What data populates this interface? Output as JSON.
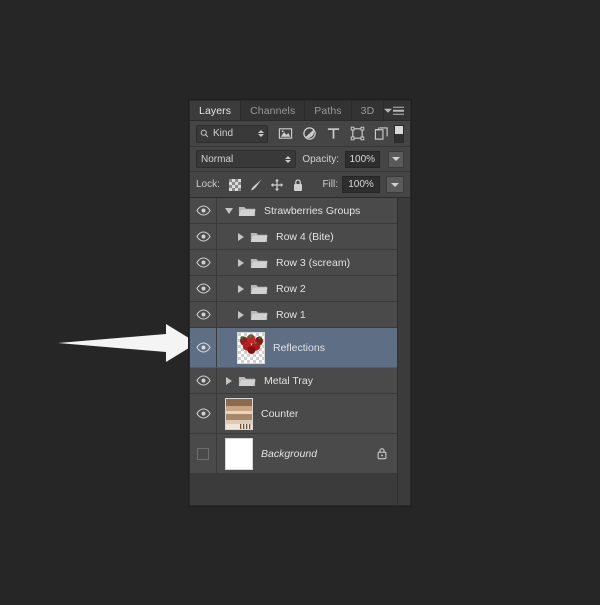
{
  "canvas": {
    "background_color": "#262626"
  },
  "annotation": {
    "name": "pointer-arrow",
    "color": "#f2f2f2",
    "points_to": "Reflections"
  },
  "panel": {
    "title": "Layers",
    "tabs": [
      {
        "label": "Layers",
        "active": true
      },
      {
        "label": "Channels",
        "active": false
      },
      {
        "label": "Paths",
        "active": false
      },
      {
        "label": "3D",
        "active": false
      }
    ],
    "panel_menu_icon": "panel-menu-icon",
    "filter": {
      "kind_label": "Kind",
      "search_icon": "search-icon",
      "icons": [
        "pixel-layer-filter-icon",
        "adjustment-layer-filter-icon",
        "type-layer-filter-icon",
        "shape-layer-filter-icon",
        "smart-object-filter-icon"
      ],
      "toggle_icon": "filter-enable-toggle"
    },
    "blend": {
      "mode_label": "Normal",
      "opacity_label": "Opacity:",
      "opacity_value": "100%"
    },
    "lock": {
      "label": "Lock:",
      "icons": [
        "lock-transparent-pixels-icon",
        "lock-image-pixels-icon",
        "lock-position-icon",
        "lock-all-icon"
      ],
      "fill_label": "Fill:",
      "fill_value": "100%"
    },
    "layers": [
      {
        "name": "Strawberries Groups",
        "type": "group",
        "expanded": true,
        "indent": 0,
        "visible": true,
        "selected": false,
        "locked": false,
        "thumb": "none"
      },
      {
        "name": "Row 4 (Bite)",
        "type": "group",
        "expanded": false,
        "indent": 1,
        "visible": true,
        "selected": false,
        "locked": false,
        "thumb": "none"
      },
      {
        "name": "Row 3 (scream)",
        "type": "group",
        "expanded": false,
        "indent": 1,
        "visible": true,
        "selected": false,
        "locked": false,
        "thumb": "none"
      },
      {
        "name": "Row 2",
        "type": "group",
        "expanded": false,
        "indent": 1,
        "visible": true,
        "selected": false,
        "locked": false,
        "thumb": "none"
      },
      {
        "name": "Row 1",
        "type": "group",
        "expanded": false,
        "indent": 1,
        "visible": true,
        "selected": false,
        "locked": false,
        "thumb": "none"
      },
      {
        "name": "Reflections",
        "type": "layer",
        "expanded": false,
        "indent": 1,
        "visible": true,
        "selected": true,
        "locked": false,
        "thumb": "strawberries-transparent"
      },
      {
        "name": "Metal Tray",
        "type": "group",
        "expanded": false,
        "indent": 0,
        "visible": true,
        "selected": false,
        "locked": false,
        "thumb": "none"
      },
      {
        "name": "Counter",
        "type": "layer",
        "expanded": false,
        "indent": 0,
        "visible": true,
        "selected": false,
        "locked": false,
        "thumb": "wood-counter"
      },
      {
        "name": "Background",
        "type": "layer",
        "expanded": false,
        "indent": 0,
        "visible": false,
        "selected": false,
        "locked": true,
        "thumb": "white"
      }
    ]
  },
  "colors": {
    "panel_bg": "#454545",
    "row_bg": "#4a4a4a",
    "selected_row": "#5d6e85",
    "text": "#e2e2e2",
    "tab_active_bg": "#3c3c3c"
  }
}
